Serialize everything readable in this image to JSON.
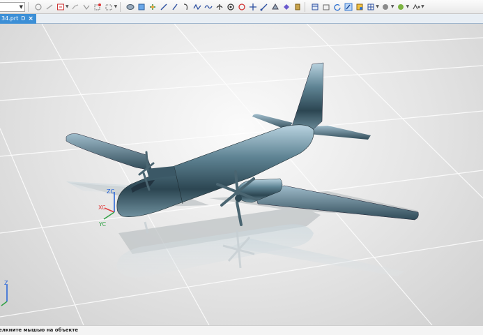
{
  "toolbar": {
    "buttons": [
      "select-icon",
      "hide-icon",
      "layer-icon",
      "show-icon",
      "link-icon",
      "box-select-icon",
      "render-icon",
      "fit-icon",
      "snap-icon",
      "line-icon",
      "pencil-icon",
      "arc-icon",
      "spline-icon",
      "curve-icon",
      "plane-icon",
      "point-icon",
      "circle-icon",
      "cross-icon",
      "measure-icon",
      "analysis-icon",
      "shade-icon",
      "filter-icon",
      "view-icon",
      "table-icon",
      "rotate-icon",
      "highlight-icon",
      "edit-icon",
      "grid-icon",
      "palette-icon",
      "material-icon",
      "tools-icon"
    ]
  },
  "tab": {
    "label": "34.prt",
    "marker": "D",
    "close": "×"
  },
  "viewport": {
    "csys": {
      "zc": "ZC",
      "xc": "XC",
      "yc": "YC"
    },
    "triad": {
      "z": "Z"
    },
    "colors": {
      "xc": "#e04040",
      "yc": "#2ea043",
      "zc": "#2060d8",
      "model": "#3f6474"
    }
  },
  "status": {
    "text": "елкните мышью на объекте"
  }
}
